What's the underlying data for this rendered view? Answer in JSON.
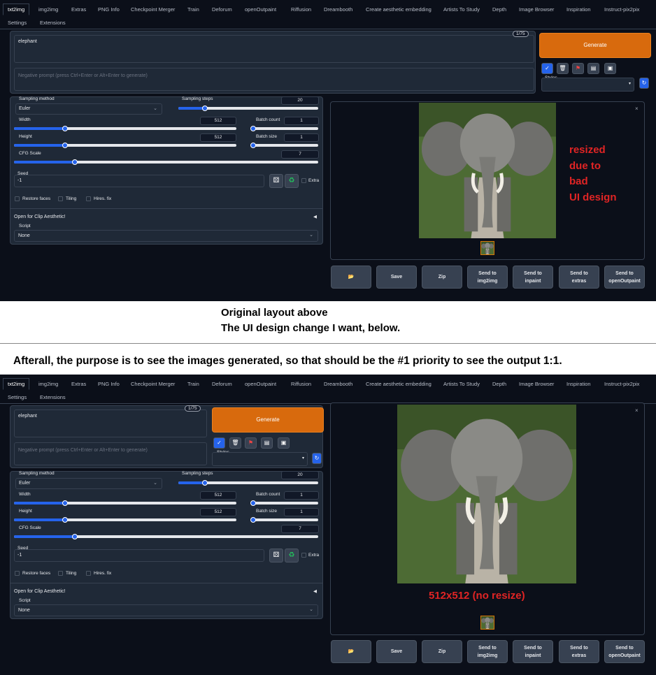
{
  "tabs": [
    "txt2img",
    "img2img",
    "Extras",
    "PNG Info",
    "Checkpoint Merger",
    "Train",
    "Deforum",
    "openOutpaint",
    "Riffusion",
    "Dreambooth",
    "Create aesthetic embedding",
    "Artists To Study",
    "Depth",
    "Image Browser",
    "Inspiration",
    "Instruct-pix2pix"
  ],
  "tabs_row2": [
    "Settings",
    "Extensions"
  ],
  "prompt": {
    "text": "elephant",
    "counter": "1/75",
    "negative_placeholder": "Negative prompt (press Ctrl+Enter or Alt+Enter to generate)"
  },
  "generate_label": "Generate",
  "styles_label": "Styles",
  "tool_icons": [
    "check-icon",
    "trash-icon",
    "flag-icon",
    "clipboard-icon",
    "save-icon"
  ],
  "params": {
    "sampling_method_label": "Sampling method",
    "sampling_method": "Euler",
    "steps_label": "Sampling steps",
    "steps": "20",
    "steps_frac": 0.19,
    "width_label": "Width",
    "width": "512",
    "width_frac": 0.23,
    "height_label": "Height",
    "height": "512",
    "height_frac": 0.23,
    "batch_count_label": "Batch count",
    "batch_count": "1",
    "batch_count_frac": 0.0,
    "batch_size_label": "Batch size",
    "batch_size": "1",
    "batch_size_frac": 0.0,
    "cfg_label": "CFG Scale",
    "cfg": "7",
    "cfg_frac": 0.2,
    "seed_label": "Seed",
    "seed": "-1",
    "extra_label": "Extra",
    "restore_faces": "Restore faces",
    "tiling": "Tiling",
    "hires": "Hires. fix",
    "clip_label": "Open for Clip Aesthetic!",
    "script_label": "Script",
    "script": "None"
  },
  "output_buttons": [
    "📂",
    "Save",
    "Zip",
    "Send to\nimg2img",
    "Send to\ninpaint",
    "Send to\nextras",
    "Send to\nopenOutpaint"
  ],
  "annotations": {
    "resized": [
      "resized",
      "due to",
      "bad",
      "UI design"
    ],
    "original_layout": "Original layout above",
    "change": "The UI design change I want, below.",
    "afterall": "Afterall, the purpose is to see the images generated, so that should be the #1 priority to see the output 1:1.",
    "no_resize": "512x512 (no resize)"
  },
  "colors": {
    "accent": "#2563eb",
    "generate": "#d86a0d",
    "annotation_red": "#e02424",
    "bg": "#0b0f19"
  }
}
